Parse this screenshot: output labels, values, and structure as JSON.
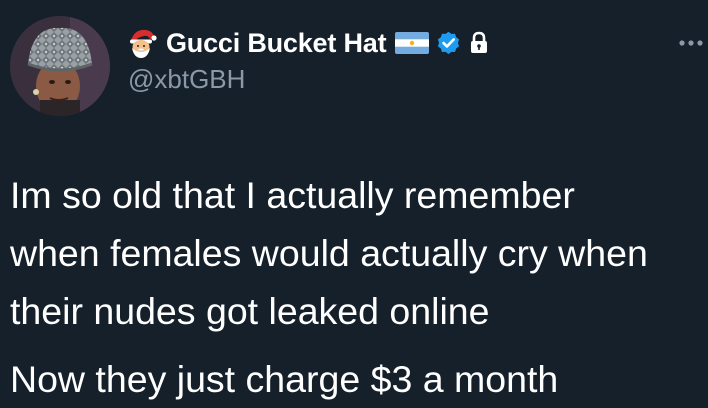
{
  "tweet": {
    "author": {
      "display_name": "Gucci Bucket Hat",
      "handle": "@xbtGBH",
      "name_emoji_icon": "santa-emoji-icon",
      "flag_icon": "argentina-flag-icon",
      "verified_icon": "verified-badge-icon",
      "protected_icon": "lock-icon",
      "avatar_icon": "profile-photo-person-bucket-hat"
    },
    "more_icon": "more-options-icon",
    "text_lines": [
      "Im so old that I actually remember",
      "when females would actually cry when",
      "their nudes got leaked online"
    ],
    "text_paragraph_2": "Now they just charge $3 a month"
  },
  "colors": {
    "background": "#15202b",
    "text_primary": "#ffffff",
    "text_secondary": "#8b98a5",
    "verified_blue": "#1d9bf0",
    "flag_blue": "#74acdf",
    "flag_sun": "#f6b40e"
  }
}
